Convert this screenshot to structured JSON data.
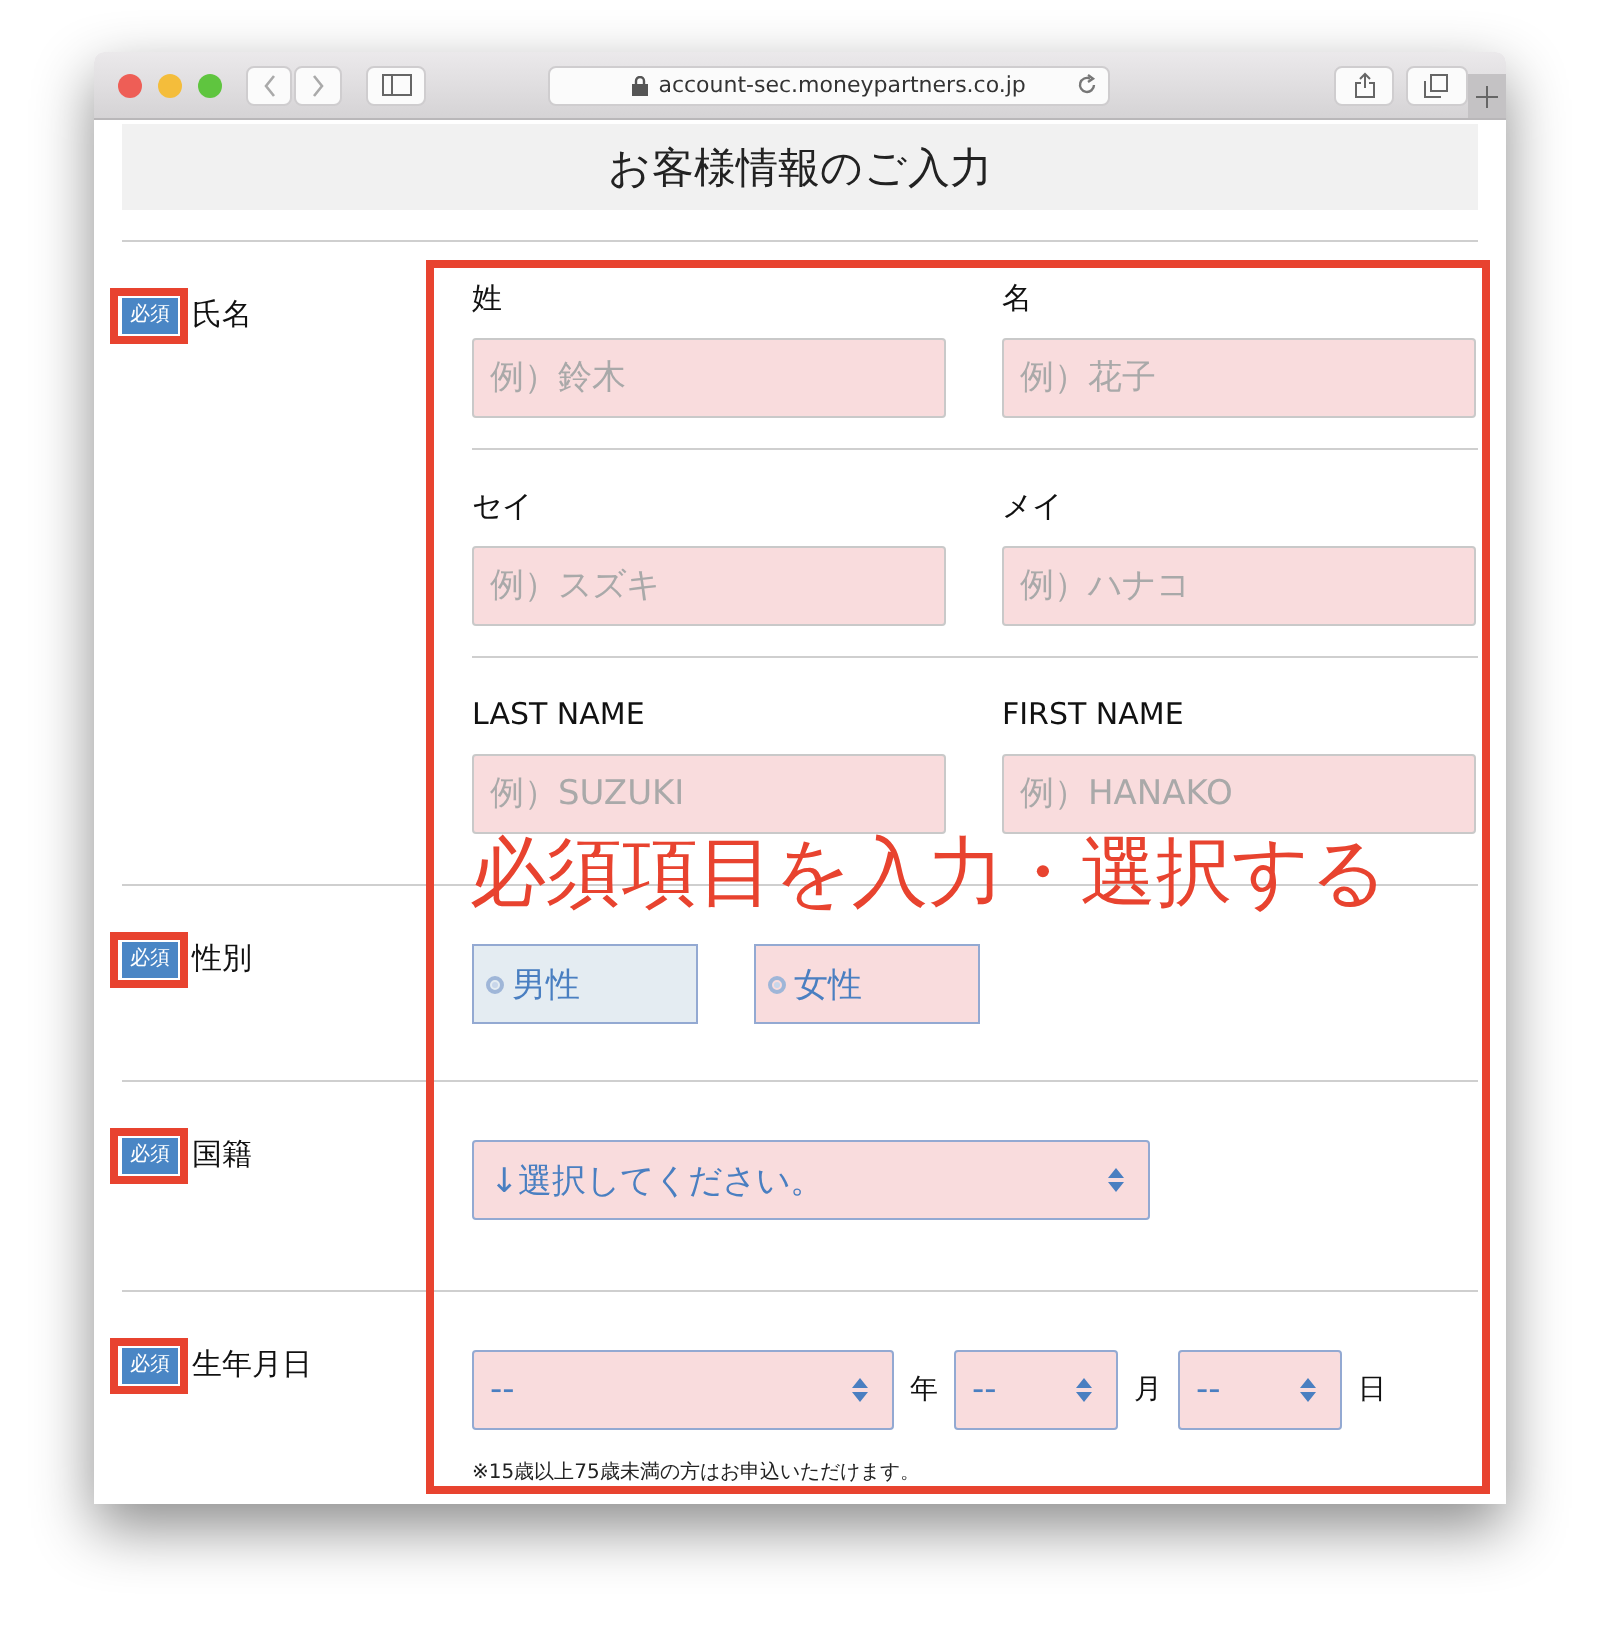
{
  "browser": {
    "url": "account-sec.moneypartners.co.jp"
  },
  "page_title": "お客様情報のご入力",
  "rows": [
    {
      "kind": "name",
      "badge": "必須",
      "badge_annotated": true,
      "label": "氏名",
      "groups": [
        {
          "fields": [
            {
              "label": "姓",
              "placeholder": "例）鈴木"
            },
            {
              "label": "名",
              "placeholder": "例）花子"
            }
          ]
        },
        {
          "fields": [
            {
              "label": "セイ",
              "placeholder": "例）スズキ"
            },
            {
              "label": "メイ",
              "placeholder": "例）ハナコ"
            }
          ]
        },
        {
          "fields": [
            {
              "label": "LAST NAME",
              "placeholder": "例）SUZUKI"
            },
            {
              "label": "FIRST NAME",
              "placeholder": "例）HANAKO"
            }
          ]
        }
      ]
    },
    {
      "kind": "radio",
      "badge": "必須",
      "badge_annotated": true,
      "label": "性別",
      "options": [
        {
          "label": "男性",
          "selected": false,
          "focused": true
        },
        {
          "label": "女性",
          "selected": false,
          "focused": false
        }
      ]
    },
    {
      "kind": "select",
      "badge": "必須",
      "badge_annotated": true,
      "label": "国籍",
      "value": "↓選択してください。"
    },
    {
      "kind": "date",
      "badge": "必須",
      "badge_annotated": true,
      "label": "生年月日",
      "selects": [
        {
          "value": "--",
          "unit": "年"
        },
        {
          "value": "--",
          "unit": "月"
        },
        {
          "value": "--",
          "unit": "日"
        }
      ],
      "note": "※15歳以上75歳未満の方はお申込いただけます。"
    }
  ],
  "annotation": {
    "text": "必須項目を入力・選択する"
  }
}
